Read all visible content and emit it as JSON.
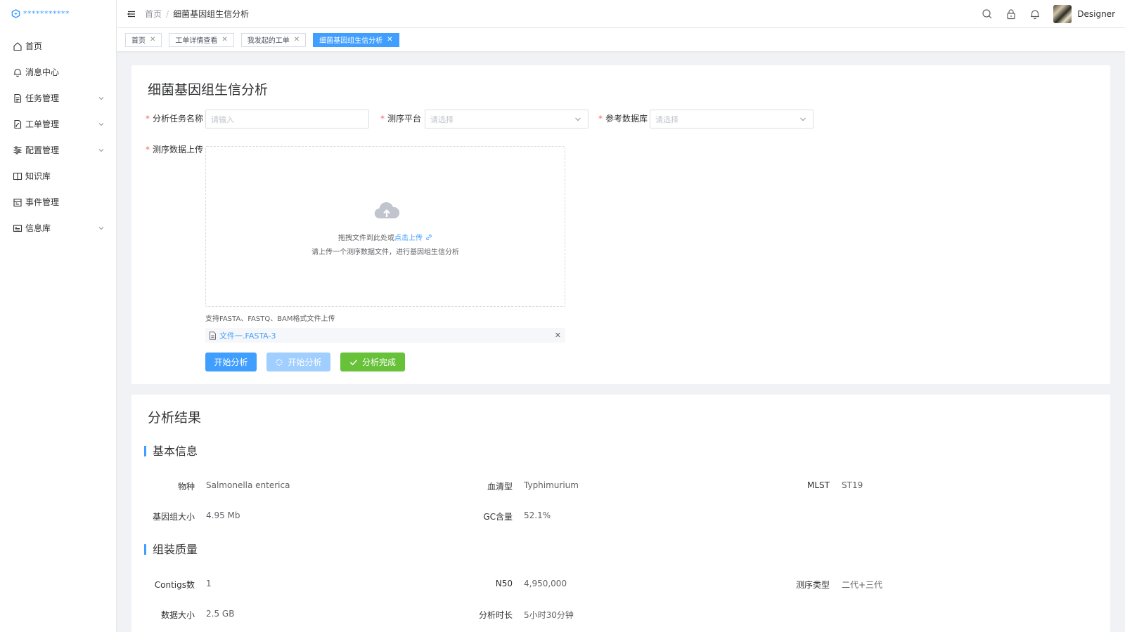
{
  "app": {
    "logo_text": "***********"
  },
  "sidebar": {
    "items": [
      {
        "label": "首页",
        "icon": "home-icon",
        "expandable": false
      },
      {
        "label": "消息中心",
        "icon": "bell-icon",
        "expandable": false
      },
      {
        "label": "任务管理",
        "icon": "document-icon",
        "expandable": true
      },
      {
        "label": "工单管理",
        "icon": "document-edit-icon",
        "expandable": true
      },
      {
        "label": "配置管理",
        "icon": "sliders-icon",
        "expandable": true
      },
      {
        "label": "知识库",
        "icon": "book-icon",
        "expandable": false
      },
      {
        "label": "事件管理",
        "icon": "calendar-icon",
        "expandable": false
      },
      {
        "label": "信息库",
        "icon": "card-icon",
        "expandable": true
      }
    ]
  },
  "header": {
    "breadcrumb_home": "首页",
    "breadcrumb_sep": "/",
    "breadcrumb_current": "细菌基因组生信分析",
    "username": "Designer"
  },
  "tabs": [
    {
      "label": "首页",
      "active": false
    },
    {
      "label": "工单详情查看",
      "active": false
    },
    {
      "label": "我发起的工单",
      "active": false
    },
    {
      "label": "细菌基因组生信分析",
      "active": true
    }
  ],
  "form": {
    "title": "细菌基因组生信分析",
    "task_name_label": "分析任务名称",
    "task_name_placeholder": "请输入",
    "platform_label": "测序平台",
    "platform_placeholder": "请选择",
    "database_label": "参考数据库",
    "database_placeholder": "请选择",
    "upload_label": "测序数据上传",
    "upload_drag_text": "拖拽文件到此处或",
    "upload_click_text": "点击上传",
    "upload_hint": "请上传一个测序数据文件，进行基因组生信分析",
    "upload_tip": "支持FASTA、FASTQ、BAM格式文件上传",
    "file_name": "文件一.FASTA-3",
    "btn_start": "开始分析",
    "btn_loading": "开始分析",
    "btn_done": "分析完成"
  },
  "results": {
    "title": "分析结果",
    "basic_title": "基本信息",
    "basic": {
      "species_label": "物种",
      "species_value": "Salmonella enterica",
      "serotype_label": "血清型",
      "serotype_value": "Typhimurium",
      "mlst_label": "MLST",
      "mlst_value": "ST19",
      "genome_label": "基因组大小",
      "genome_value": "4.95 Mb",
      "gc_label": "GC含量",
      "gc_value": "52.1%"
    },
    "quality_title": "组装质量",
    "quality": {
      "contigs_label": "Contigs数",
      "contigs_value": "1",
      "n50_label": "N50",
      "n50_value": "4,950,000",
      "seqtype_label": "测序类型",
      "seqtype_value": "二代+三代",
      "datasize_label": "数据大小",
      "datasize_value": "2.5 GB",
      "duration_label": "分析时长",
      "duration_value": "5小时30分钟"
    }
  }
}
